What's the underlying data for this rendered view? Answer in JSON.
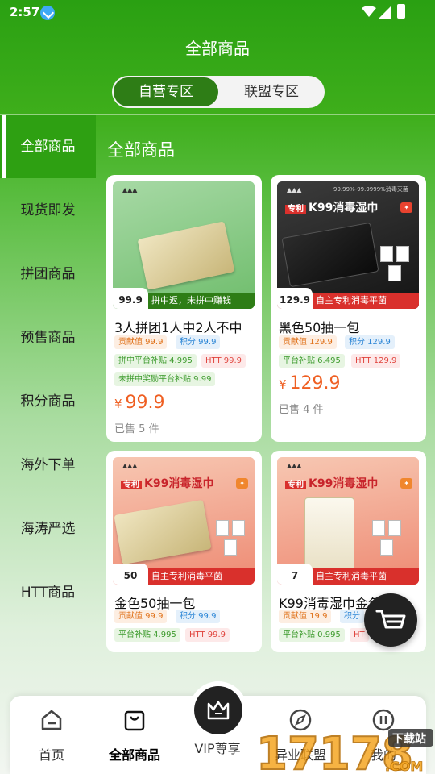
{
  "status_bar": {
    "time": "2:57"
  },
  "header": {
    "title": "全部商品"
  },
  "segment": {
    "tabs": [
      "自营专区",
      "联盟专区"
    ]
  },
  "sidebar": {
    "items": [
      {
        "label": "全部商品"
      },
      {
        "label": "现货即发"
      },
      {
        "label": "拼团商品"
      },
      {
        "label": "预售商品"
      },
      {
        "label": "积分商品"
      },
      {
        "label": "海外下单"
      },
      {
        "label": "海涛严选"
      },
      {
        "label": "HTT商品"
      }
    ]
  },
  "section_title": "全部商品",
  "products": [
    {
      "title": "3人拼团1人中2人不中",
      "image_price": "99.9",
      "image_banner": "拼中返，未拼中赚钱",
      "tags": [
        "贡献值 99.9",
        "积分 99.9",
        "拼中平台补贴 4.995",
        "HTT 99.9",
        "未拼中奖励平台补贴 9.99"
      ],
      "currency": "¥",
      "price": "99.9",
      "sold": "已售 5 件"
    },
    {
      "title": "黑色50抽一包",
      "image_price": "129.9",
      "image_banner": "自主专利消毒平菌",
      "image_header": "K99消毒湿巾",
      "image_badge": "专利",
      "image_slogan": "99.99%-99.9999%消毒灭菌",
      "tags": [
        "贡献值 129.9",
        "积分 129.9",
        "平台补贴 6.495",
        "HTT 129.9"
      ],
      "currency": "¥",
      "price": "129.9",
      "sold": "已售 4 件"
    },
    {
      "title": "金色50抽一包",
      "image_price": "50",
      "image_banner": "自主专利消毒平菌",
      "image_header": "K99消毒湿巾",
      "image_badge": "专利",
      "tags": [
        "贡献值 99.9",
        "积分 99.9",
        "平台补贴 4.995",
        "HTT 99.9"
      ]
    },
    {
      "title": "K99消毒湿巾金色7片",
      "image_price": "7",
      "image_banner": "自主专利消毒平菌",
      "image_header": "K99消毒湿巾",
      "image_badge": "专利",
      "tags": [
        "贡献值 19.9",
        "积分",
        "平台补贴 0.995",
        "HT"
      ]
    }
  ],
  "bottom_nav": [
    {
      "label": "首页",
      "icon": "home-icon"
    },
    {
      "label": "全部商品",
      "icon": "shopping-bag-icon",
      "active": true
    },
    {
      "label": "VIP尊享",
      "icon": "crown-icon"
    },
    {
      "label": "异业联盟",
      "icon": "compass-icon"
    },
    {
      "label": "我的",
      "icon": "profile-icon"
    }
  ],
  "watermark": {
    "text": "17178",
    "suffix": ".COM",
    "tag": "下载站"
  },
  "colors": {
    "brand_green": "#2ea012",
    "price_orange": "#ef5f22"
  }
}
